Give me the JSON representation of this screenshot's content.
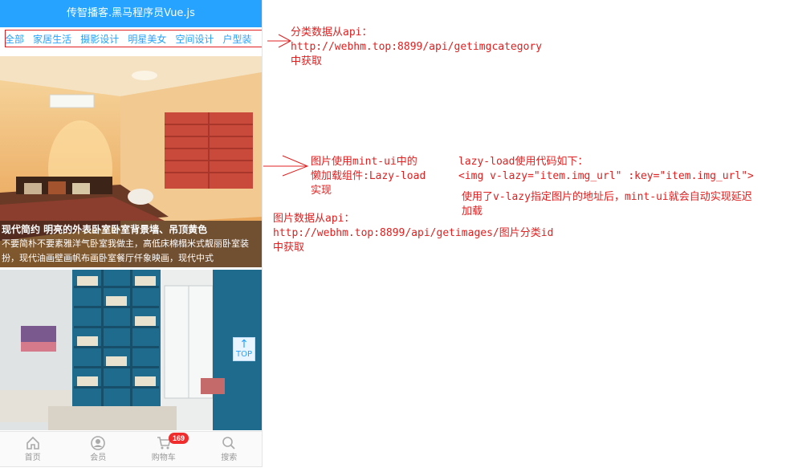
{
  "header": {
    "title": "传智播客.黑马程序员Vue.js"
  },
  "categories": [
    "全部",
    "家居生活",
    "摄影设计",
    "明星美女",
    "空间设计",
    "户型装"
  ],
  "photos": [
    {
      "title": "现代简约 明亮的外表卧室卧室背景墙、吊顶黄色",
      "description": "不要简朴不要素雅洋气卧室我做主，高低床棉榻米式靓丽卧室装扮，现代油画壁画帆布画卧室餐厅仟象映画，现代中式"
    },
    {
      "title": "",
      "description": ""
    }
  ],
  "top_button": {
    "label": "TOP"
  },
  "tabbar": {
    "items": [
      {
        "label": "首页",
        "icon": "home-icon"
      },
      {
        "label": "会员",
        "icon": "member-icon"
      },
      {
        "label": "购物车",
        "icon": "cart-icon",
        "badge": "169"
      },
      {
        "label": "搜索",
        "icon": "search-icon"
      }
    ]
  },
  "annotations": {
    "category": [
      "分类数据从api：",
      "http://webhm.top:8899/api/getimgcategory",
      "中获取"
    ],
    "lazyload": [
      "图片使用mint-ui中的",
      "懒加载组件:Lazy-load",
      "实现"
    ],
    "code": [
      "lazy-load使用代码如下：",
      "<img v-lazy=\"item.img_url\" :key=\"item.img_url\">"
    ],
    "explain": [
      "使用了v-lazy指定图片的地址后，mint-ui就会自动实现延迟",
      "加载"
    ],
    "images": [
      "图片数据从api：",
      "http://webhm.top:8899/api/getimages/图片分类id",
      "中获取"
    ]
  },
  "colors": {
    "accent": "#26a2ff",
    "annotation": "#e02020",
    "badge": "#f02c2c"
  }
}
